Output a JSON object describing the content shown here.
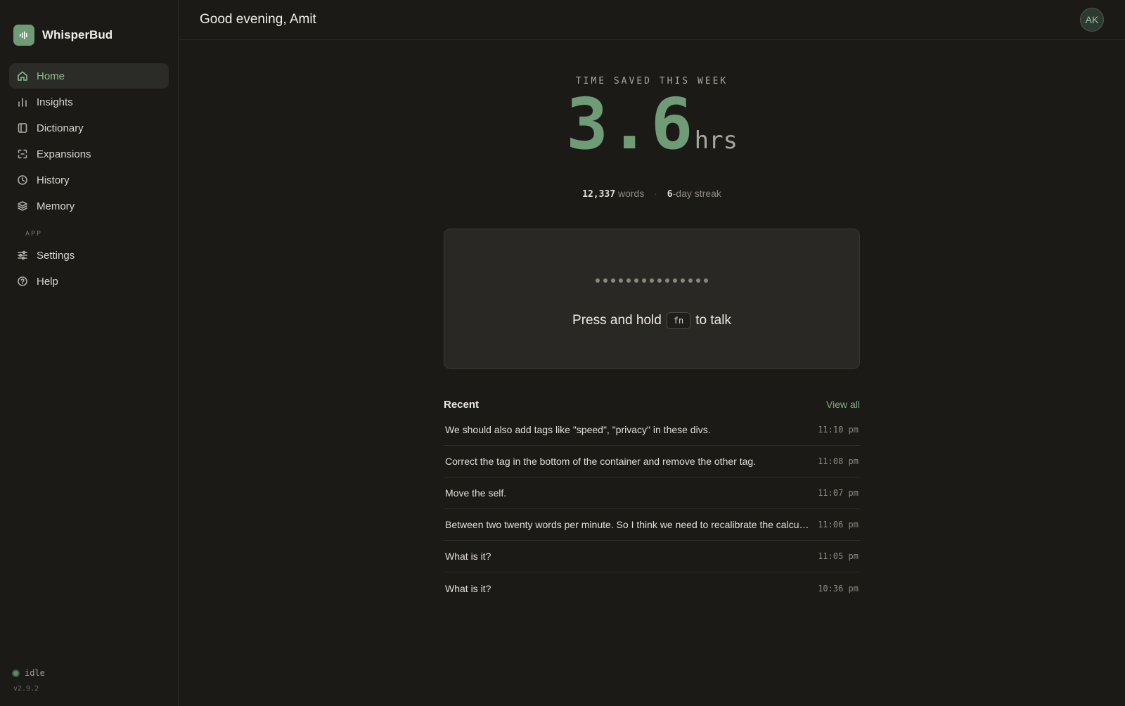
{
  "app": {
    "name": "WhisperBud",
    "logo_icon": "waveform-icon",
    "accent": "#6f9c76"
  },
  "sidebar": {
    "items": [
      {
        "label": "Home",
        "icon": "home-icon",
        "active": true
      },
      {
        "label": "Insights",
        "icon": "bar-chart-icon"
      },
      {
        "label": "Dictionary",
        "icon": "book-icon"
      },
      {
        "label": "Expansions",
        "icon": "expand-icon"
      },
      {
        "label": "History",
        "icon": "clock-icon"
      },
      {
        "label": "Memory",
        "icon": "layers-icon"
      }
    ],
    "section_label": "APP",
    "app_items": [
      {
        "label": "Settings",
        "icon": "sliders-icon"
      },
      {
        "label": "Help",
        "icon": "help-circle-icon"
      }
    ],
    "status": "idle",
    "version": "v2.9.2"
  },
  "header": {
    "greeting": "Good evening, Amit",
    "avatar_initials": "AK"
  },
  "stats": {
    "label": "TIME SAVED THIS WEEK",
    "value": "3.6",
    "unit": "hrs",
    "words_value": "12,337",
    "words_label": "words",
    "streak_value": "6",
    "streak_label": "-day streak"
  },
  "talk": {
    "prefix": "Press and hold",
    "key": "fn",
    "suffix": "to talk",
    "dot_count": 15
  },
  "recent": {
    "title": "Recent",
    "view_all": "View all",
    "items": [
      {
        "text": "We should also add tags like \"speed\", \"privacy\" in these divs.",
        "time": "11:10 pm"
      },
      {
        "text": "Correct the tag in the bottom of the container and remove the other tag.",
        "time": "11:08 pm"
      },
      {
        "text": "Move the self.",
        "time": "11:07 pm"
      },
      {
        "text": "Between two twenty words per minute. So I think we need to recalibrate the calcul...",
        "time": "11:06 pm"
      },
      {
        "text": "What is it?",
        "time": "11:05 pm"
      },
      {
        "text": "What is it?",
        "time": "10:36 pm"
      }
    ]
  }
}
